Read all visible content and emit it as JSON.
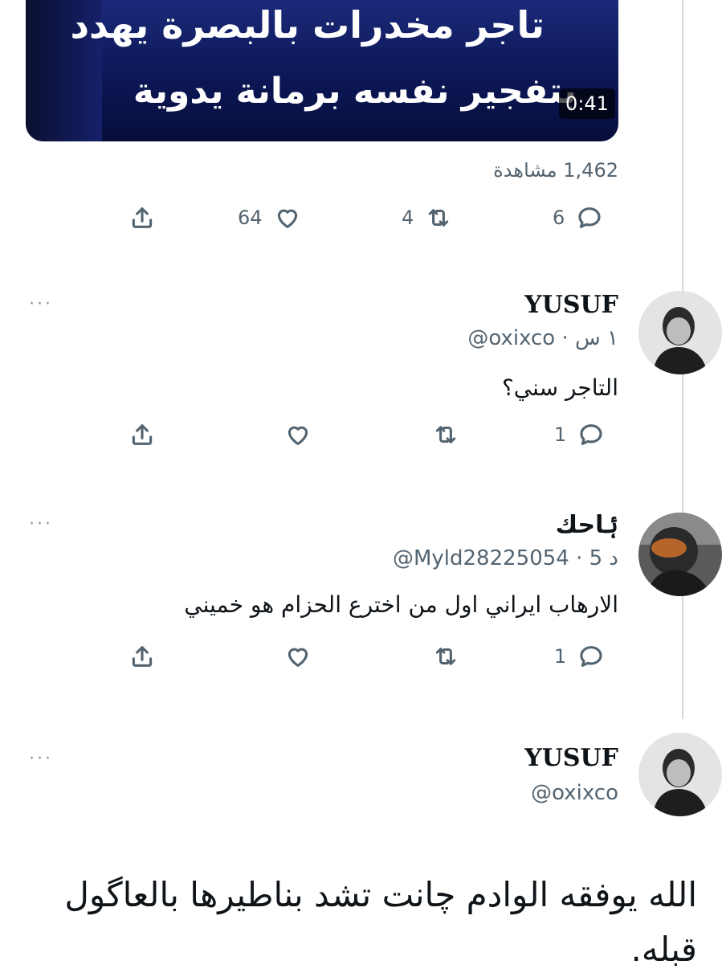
{
  "video": {
    "headline_line1": "تاجر مخدرات بالبصرة يهدد",
    "headline_line2": "بتفجير نفسه برمانة يدوية",
    "duration": "0:41"
  },
  "views_text": "1,462 مشاهدة",
  "main_tweet_actions": {
    "replies": "6",
    "retweets": "4",
    "likes": "64"
  },
  "replies": [
    {
      "display_name": "YUSUF",
      "handle_meta": "@oxixco · ١ س",
      "text": "التاجر سني؟",
      "reply_count": "1",
      "more": "···"
    },
    {
      "display_name": "ۂاحك",
      "handle_meta": "@Myld28225054 · 5 د",
      "text": "الارهاب ايراني اول من اخترع الحزام هو خميني",
      "reply_count": "1",
      "more": "···"
    }
  ],
  "composer": {
    "display_name": "YUSUF",
    "handle": "@oxixco",
    "more": "···",
    "text": "الله يوفقه الوادم چانت تشد بناطيرها بالعاگول قبله."
  },
  "icons": [
    "reply-icon",
    "retweet-icon",
    "like-icon",
    "share-icon",
    "avatar-image"
  ],
  "colors": {
    "icon_gray": "#536471",
    "text": "#0f1419",
    "thread_line": "#cfd9de",
    "video_bg": "#0c1756"
  }
}
